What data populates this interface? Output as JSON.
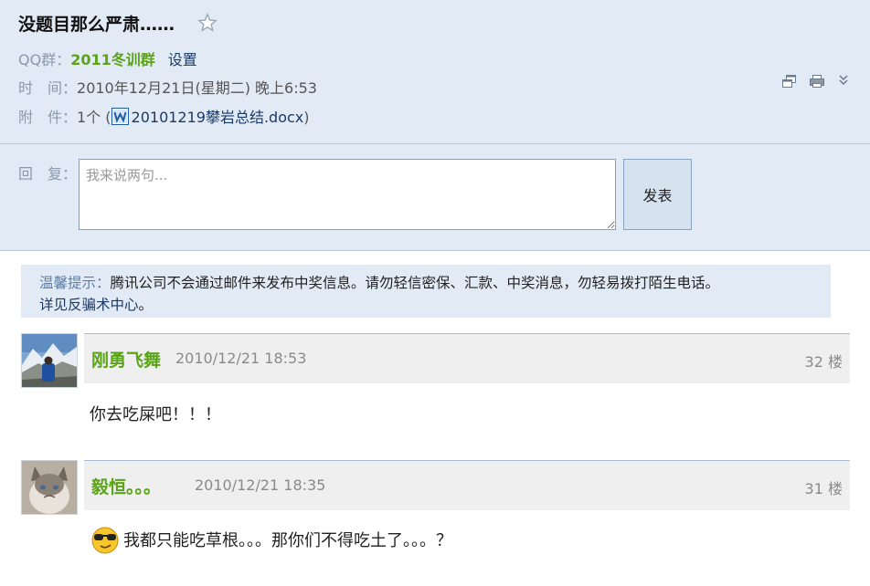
{
  "mail": {
    "subject": "没题目那么严肃……",
    "group_label": "QQ群：",
    "group_name": "2011冬训群",
    "settings_link": "设置",
    "time_label": "时　间：",
    "time_value": "2010年12月21日(星期二) 晚上",
    "time_clock": "6:53",
    "attach_label": "附　件：",
    "attach_count": "1个 (",
    "attach_file": "20101219攀岩总结.docx",
    "attach_close": ")"
  },
  "reply": {
    "label": "回　复：",
    "placeholder": "我来说两句...",
    "submit_label": "发表"
  },
  "notice": {
    "label": "温馨提示：",
    "text": "腾讯公司不会通过邮件来发布中奖信息。请勿轻信密保、汇款、中奖消息，勿轻易拨打陌生电话。",
    "link": "详见反骗术中心",
    "end": "。"
  },
  "posts": [
    {
      "author": "刚勇飞舞",
      "time": "2010/12/21 18:53",
      "floor": "32 楼",
      "content": "你去吃屎吧！！！"
    },
    {
      "author": "毅恒。。。",
      "time": "2010/12/21 18:35",
      "floor": "31 楼",
      "content": "我都只能吃草根。。。那你们不得吃土了。。。？"
    }
  ],
  "icons": {
    "star": "star-icon",
    "new_window": "new-window-icon",
    "print": "print-icon",
    "collapse": "collapse-icon",
    "doc": "word-document-icon",
    "emoji": "cool-sunglasses-emoji-icon"
  },
  "colors": {
    "header_bg": "#e1eaf5",
    "author_green": "#5ba318",
    "link_blue": "#1b3a66",
    "label_gray": "#8b99aa"
  }
}
